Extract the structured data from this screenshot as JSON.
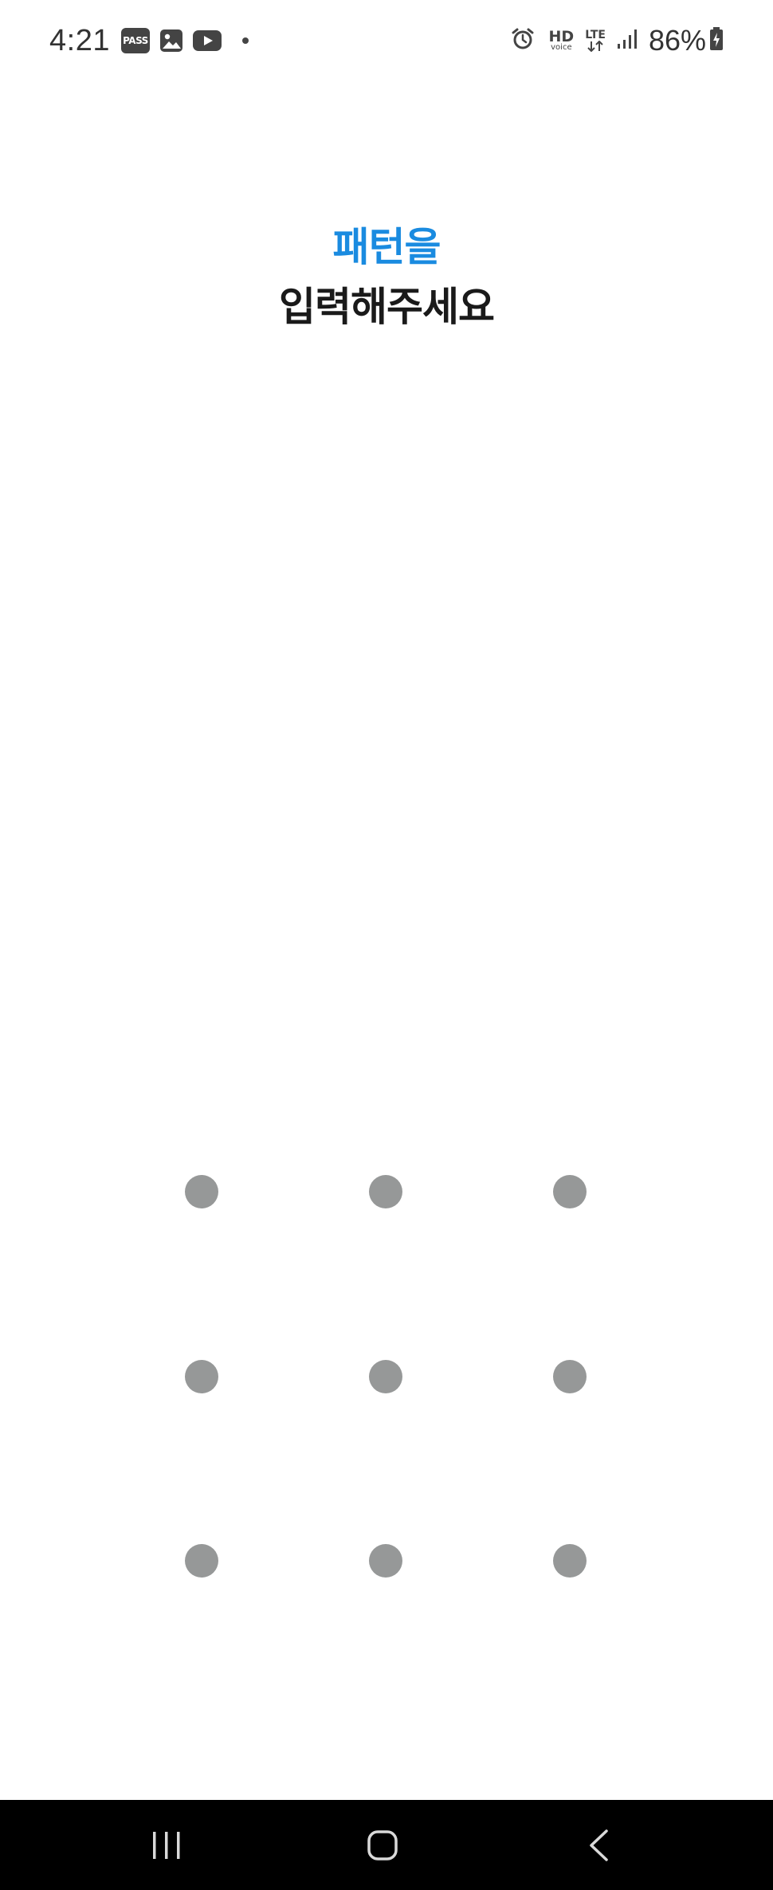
{
  "status_bar": {
    "time": "4:21",
    "notification_icons": [
      "pass-app-icon",
      "gallery-icon",
      "youtube-icon",
      "more-notifications-dot"
    ],
    "pass_label": "PASS",
    "system_icons": [
      "alarm-icon",
      "hd-voice-icon",
      "lte-data-icon",
      "signal-icon",
      "battery-charging-icon"
    ],
    "hd_label": "HD",
    "voice_label": "voice",
    "lte_label": "LTE",
    "battery_percent": "86%"
  },
  "heading": {
    "line1": "패턴을",
    "line2": "입력해주세요"
  },
  "pattern_lock": {
    "rows": 3,
    "columns": 3,
    "dot_color": "#969898"
  },
  "colors": {
    "accent": "#1a8be0",
    "heading_text": "#1a1a1a",
    "nav_bar_background": "#000000",
    "nav_icon": "#d9d9d9"
  },
  "nav_bar": {
    "buttons": [
      "recent-apps-icon",
      "home-icon",
      "back-icon"
    ]
  }
}
